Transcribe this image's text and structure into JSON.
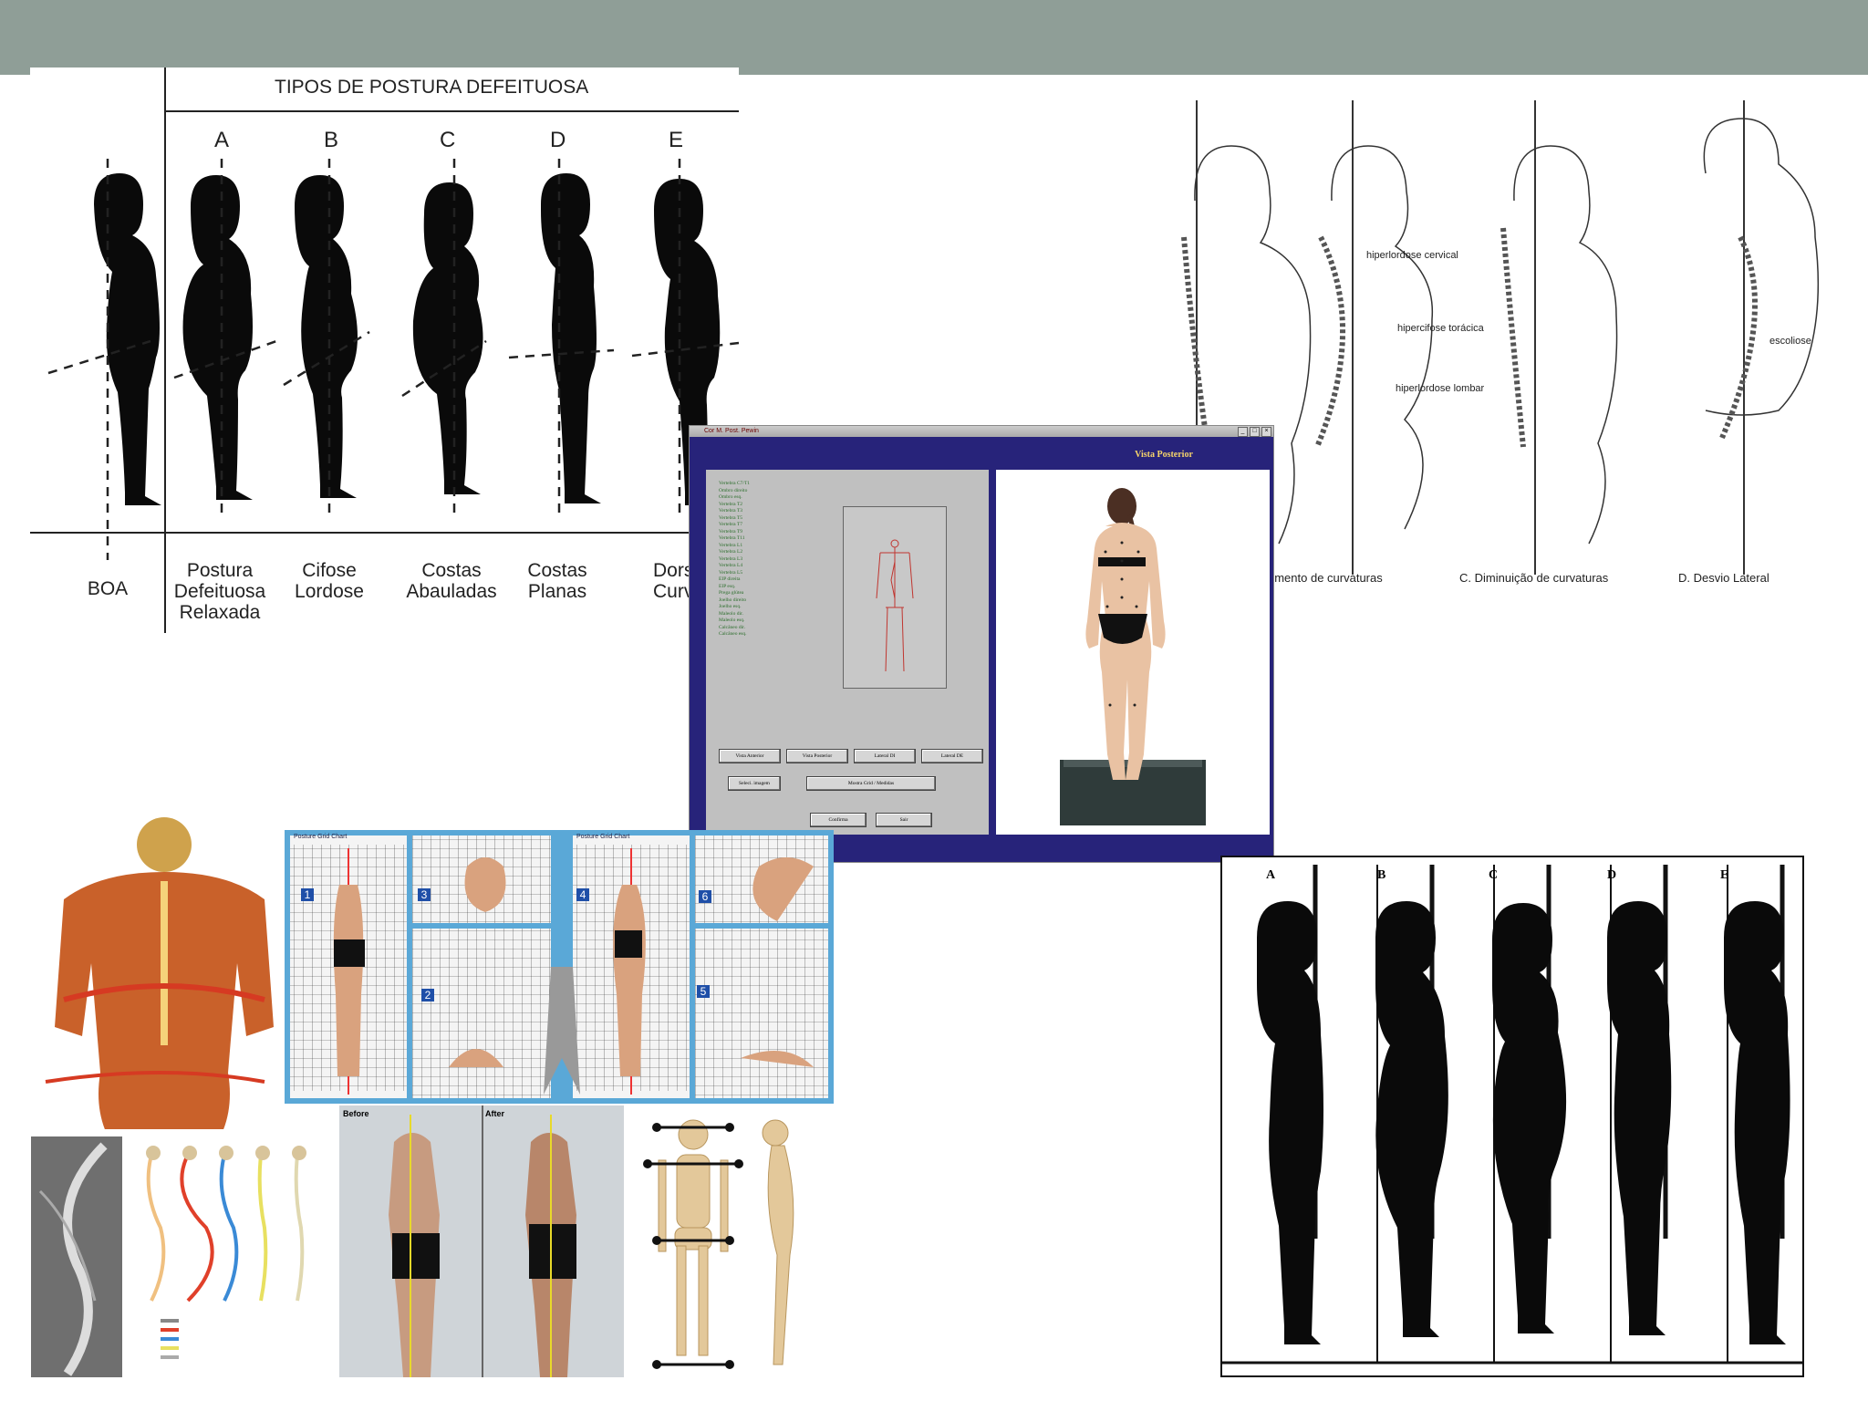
{
  "colors": {
    "header_bar": "#8f9e97",
    "window_bg": "#27237a",
    "window_heading": "#f5d36b",
    "landmark_text": "#2b6e2b"
  },
  "chart1": {
    "title": "TIPOS DE POSTURA DEFEITUOSA",
    "letters": [
      "A",
      "B",
      "C",
      "D",
      "E"
    ],
    "labels": [
      [
        "BOA"
      ],
      [
        "Postura",
        "Defeituosa",
        "Relaxada"
      ],
      [
        "Cifose",
        "Lordose"
      ],
      [
        "Costas",
        "Abauladas"
      ],
      [
        "Costas",
        "Planas"
      ],
      [
        "Dors",
        "Curv"
      ]
    ]
  },
  "spine_chart": {
    "annotations": [
      "hiperlordose cervical",
      "hipercifose torácica",
      "hiperlordose lombar",
      "escoliose"
    ],
    "captions": [
      "umento de curvaturas",
      "C. Diminuição de curvaturas",
      "D. Desvio Lateral"
    ]
  },
  "software": {
    "window_title": "Cor M. Post. Pewin",
    "view_title": "Vista Posterior",
    "landmarks": [
      "Vertebra C7/T1",
      "Ombro direito",
      "Ombro esq.",
      "Vertebra T2",
      "Vertebra T3",
      "Vertebra T5",
      "Vertebra T7",
      "Vertebra T9",
      "Vertebra T11",
      "Vertebra L1",
      "Vertebra L2",
      "Vertebra L3",
      "Vertebra L4",
      "Vertebra L5",
      "EIP direita",
      "EIP esq.",
      "Prega glútea",
      "Joelho direito",
      "Joelho esq.",
      "Maleolo dir.",
      "Maleolo esq.",
      "Calcâneo dir.",
      "Calcâneo esq."
    ],
    "buttons": {
      "view_front": "Vista Anterior",
      "view_back": "Vista Posterior",
      "side_left": "Lateral DI",
      "side_right": "Lateral DE",
      "select_image": "Seleci. imagem",
      "display": "Mostra Grid / Medidas",
      "finish": "Confirma",
      "quit": "Sair"
    }
  },
  "chart3": {
    "letters": [
      "A",
      "B",
      "C",
      "D",
      "E"
    ]
  },
  "grid_panel": {
    "numbers": [
      "1",
      "2",
      "3",
      "4",
      "5",
      "6"
    ],
    "header_left": "Posture Grid Chart",
    "header_right": "Posture Grid Chart"
  },
  "photo_panel": {
    "labels": [
      "Before",
      "After"
    ]
  }
}
